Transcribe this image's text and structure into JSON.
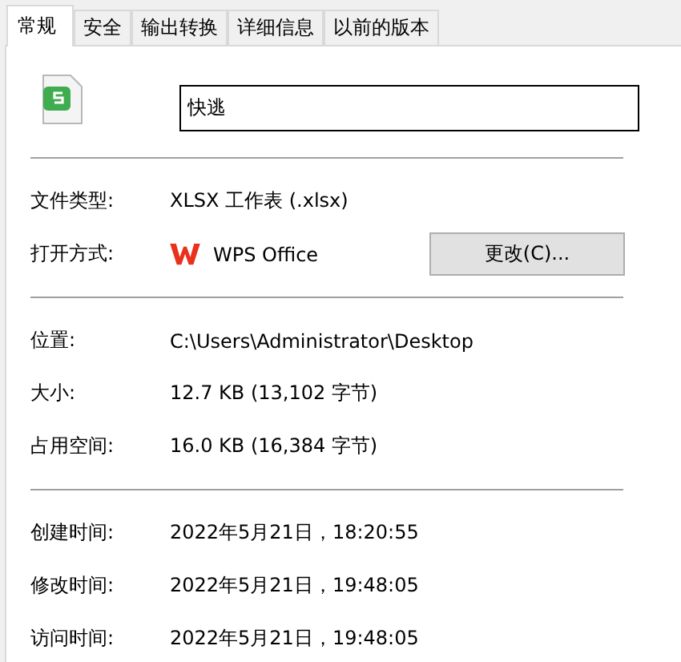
{
  "tabs": [
    {
      "label": "常规",
      "selected": true
    },
    {
      "label": "安全",
      "selected": false
    },
    {
      "label": "输出转换",
      "selected": false
    },
    {
      "label": "详细信息",
      "selected": false
    },
    {
      "label": "以前的版本",
      "selected": false
    }
  ],
  "file": {
    "name": "快逃"
  },
  "sections": [
    [
      {
        "kind": "text",
        "label": "文件类型:",
        "value": "XLSX 工作表 (.xlsx)"
      },
      {
        "kind": "app",
        "label": "打开方式:",
        "value": "WPS Office",
        "button": "更改(C)..."
      }
    ],
    [
      {
        "kind": "text",
        "label": "位置:",
        "value": "C:\\Users\\Administrator\\Desktop"
      },
      {
        "kind": "text",
        "label": "大小:",
        "value": "12.7 KB (13,102 字节)"
      },
      {
        "kind": "text",
        "label": "占用空间:",
        "value": "16.0 KB (16,384 字节)"
      }
    ],
    [
      {
        "kind": "text",
        "label": "创建时间:",
        "value": "2022年5月21日，18:20:55"
      },
      {
        "kind": "text",
        "label": "修改时间:",
        "value": "2022年5月21日，19:48:05"
      },
      {
        "kind": "text",
        "label": "访问时间:",
        "value": "2022年5月21日，19:48:05"
      }
    ]
  ]
}
